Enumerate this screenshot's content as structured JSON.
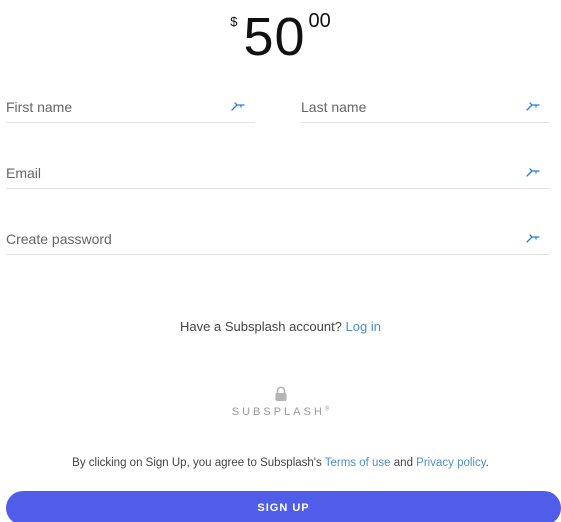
{
  "amount": {
    "currency": "$",
    "whole": "50",
    "cents": "00"
  },
  "form": {
    "first_name_placeholder": "First name",
    "last_name_placeholder": "Last name",
    "email_placeholder": "Email",
    "password_placeholder": "Create password",
    "autofill_icon": "autofill-key-icon"
  },
  "login": {
    "prompt": "Have a Subsplash account?",
    "link": "Log in"
  },
  "secure": {
    "icon": "lock-icon",
    "brand": "SUBSPLASH",
    "trademark": "®"
  },
  "terms": {
    "prefix": "By clicking on Sign Up, you agree to Subsplash's",
    "terms_link": "Terms of use",
    "conjunction": "and",
    "privacy_link": "Privacy policy",
    "suffix": "."
  },
  "signup": {
    "label": "SIGN UP"
  },
  "colors": {
    "accent": "#4f5de9",
    "link": "#4b8fd3",
    "autofill_icon": "#2a7de1"
  }
}
